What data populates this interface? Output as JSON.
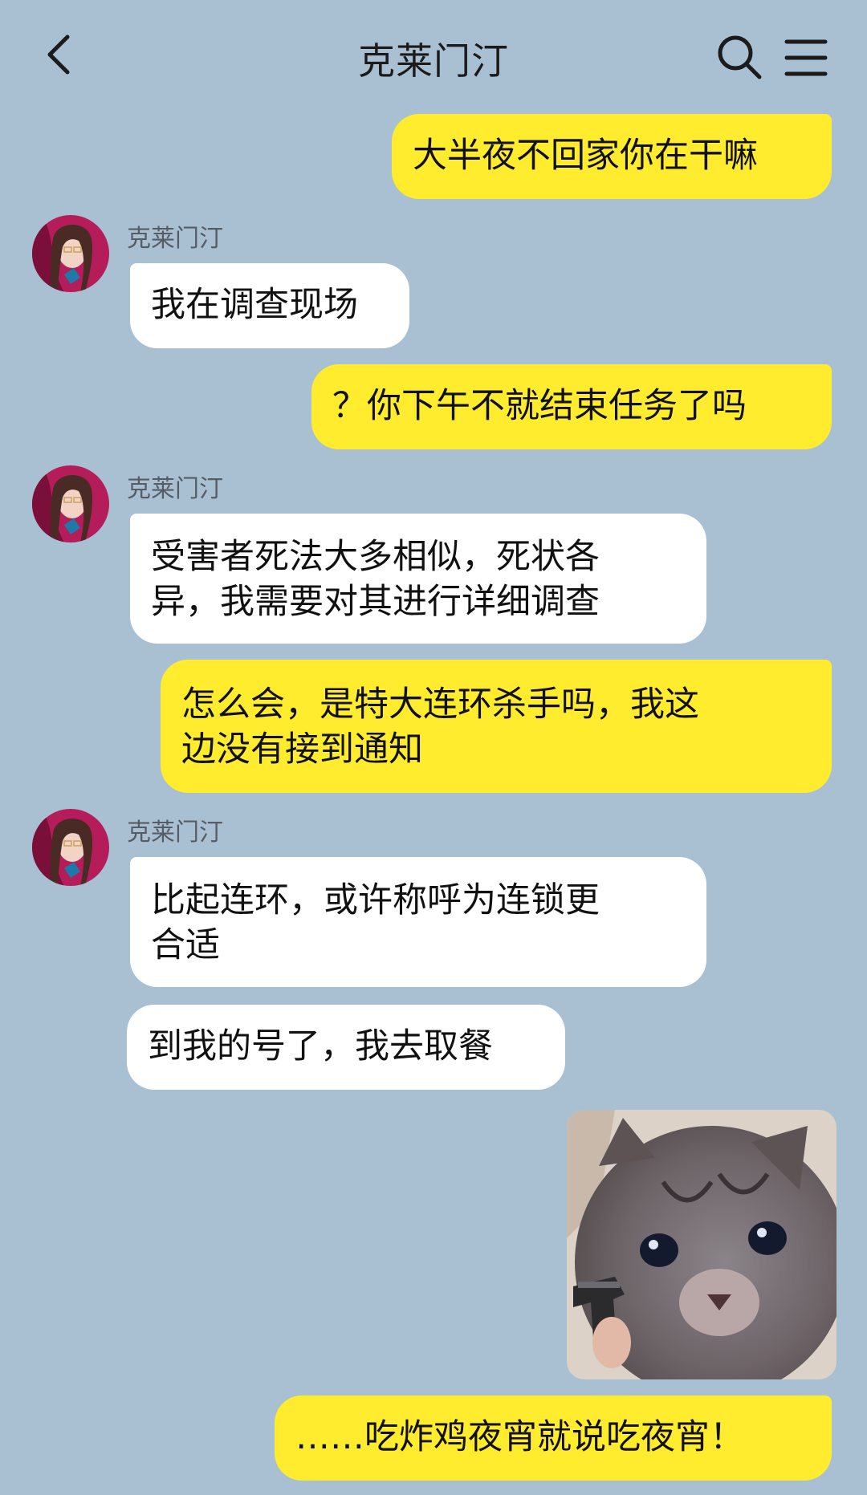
{
  "header": {
    "title": "克莱门汀",
    "back_icon": "chevron-left-icon",
    "search_icon": "search-icon",
    "menu_icon": "menu-icon"
  },
  "contact": {
    "name": "克莱门汀",
    "avatar_icon": "avatar-portrait"
  },
  "messages": [
    {
      "from": "me",
      "text": "大半夜不回家你在干嘛"
    },
    {
      "from": "contact",
      "sender": "克莱门汀",
      "text": "我在调查现场"
    },
    {
      "from": "me",
      "text": "？你下午不就结束任务了吗"
    },
    {
      "from": "contact",
      "sender": "克莱门汀",
      "lines": [
        "受害者死法大多相似，死状各",
        "异，我需要对其进行详细调查"
      ]
    },
    {
      "from": "me",
      "lines": [
        "怎么会，是特大连环杀手吗，我这",
        "边没有接到通知"
      ]
    },
    {
      "from": "contact",
      "sender": "克莱门汀",
      "lines": [
        "比起连环，或许称呼为连锁更",
        "合适"
      ]
    },
    {
      "from": "contact",
      "text": "到我的号了，我去取餐"
    },
    {
      "from": "me",
      "type": "sticker",
      "sticker": "crying-kitten-with-gun-sticker"
    },
    {
      "from": "me",
      "text": "……吃炸鸡夜宵就说吃夜宵！"
    }
  ],
  "colors": {
    "background": "#a9bfd2",
    "outgoing_bubble": "#ffec2e",
    "incoming_bubble": "#ffffff"
  }
}
